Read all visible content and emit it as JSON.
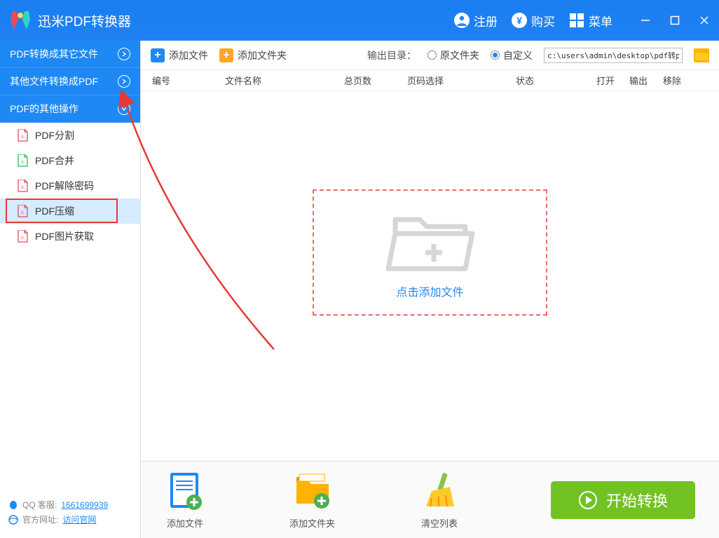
{
  "titlebar": {
    "app_name": "迅米PDF转换器",
    "register": "注册",
    "buy": "购买",
    "menu": "菜单"
  },
  "sidebar": {
    "cat1": "PDF转换成其它文件",
    "cat2": "其他文件转换成PDF",
    "cat3": "PDF的其他操作",
    "items": {
      "split": "PDF分割",
      "merge": "PDF合并",
      "decrypt": "PDF解除密码",
      "compress": "PDF压缩",
      "extract": "PDF图片获取"
    },
    "footer": {
      "qq_label": "QQ 客服:",
      "qq_number": "1661699939",
      "site_label": "官方网址:",
      "site_link": "访问官网"
    }
  },
  "toolbar": {
    "add_file": "添加文件",
    "add_folder": "添加文件夹",
    "output_label": "输出目录：",
    "opt_source": "原文件夹",
    "opt_custom": "自定义",
    "path_value": "c:\\users\\admin\\desktop\\pdf转ppt"
  },
  "table": {
    "num": "编号",
    "name": "文件名称",
    "pages": "总页数",
    "page_sel": "页码选择",
    "status": "状态",
    "open": "打开",
    "output": "输出",
    "delete": "移除"
  },
  "dropzone": {
    "text": "点击添加文件"
  },
  "bottom": {
    "add_file": "添加文件",
    "add_folder": "添加文件夹",
    "clear_list": "清空列表",
    "start": "开始转换"
  }
}
